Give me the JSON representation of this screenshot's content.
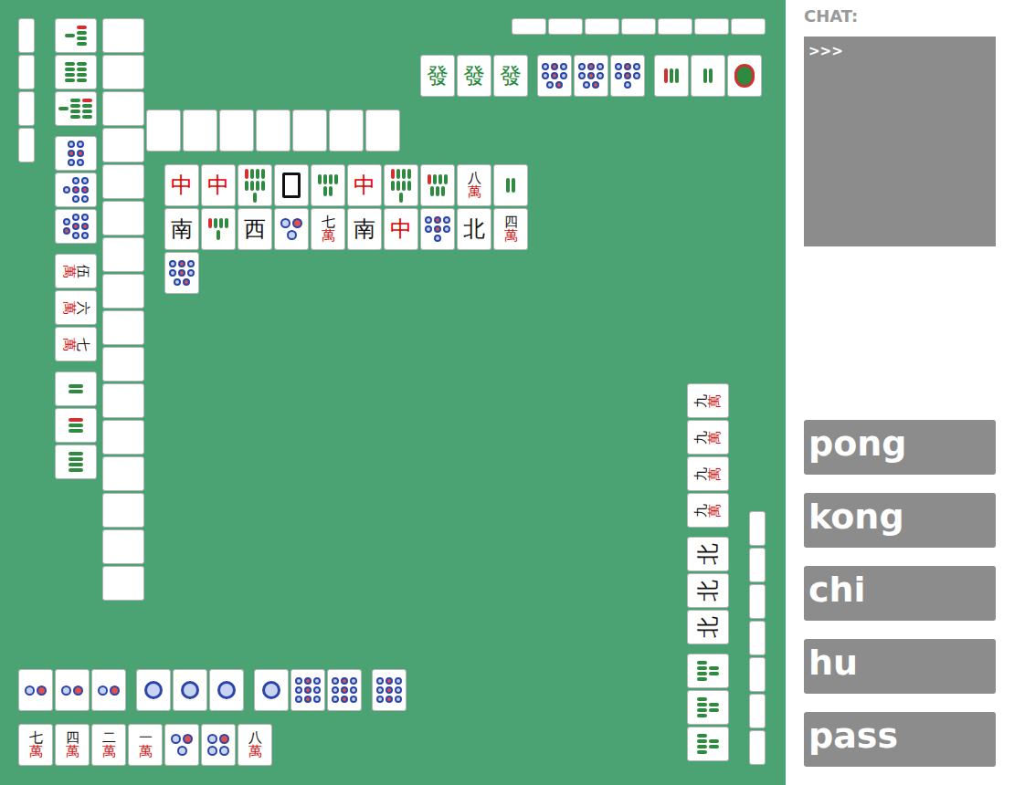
{
  "table": {
    "north": {
      "hidden_count": 7,
      "wall_count": 7,
      "melds": [
        [
          {
            "kind": "honor",
            "label": "發",
            "color": "#1f8a3a"
          },
          {
            "kind": "honor",
            "label": "發",
            "color": "#1f8a3a"
          },
          {
            "kind": "honor",
            "label": "發",
            "color": "#1f8a3a"
          }
        ],
        [
          {
            "kind": "dots",
            "count": 8
          },
          {
            "kind": "dots",
            "count": 8
          },
          {
            "kind": "dots",
            "count": 7
          }
        ],
        [
          {
            "kind": "bamboo",
            "count": 3
          },
          {
            "kind": "bamboo",
            "count": 2
          },
          {
            "kind": "bamboo",
            "count": 1
          }
        ]
      ]
    },
    "west": {
      "hidden_count": 4,
      "wall_count": 16,
      "melds": [
        [
          {
            "kind": "bamboo",
            "count": 5
          },
          {
            "kind": "bamboo",
            "count": 8
          },
          {
            "kind": "bamboo",
            "count": 9
          }
        ],
        [
          {
            "kind": "dots",
            "count": 6
          },
          {
            "kind": "dots",
            "count": 7
          },
          {
            "kind": "dots",
            "count": 8
          }
        ],
        [
          {
            "kind": "man",
            "rank": "伍",
            "suit": "萬"
          },
          {
            "kind": "man",
            "rank": "六",
            "suit": "萬"
          },
          {
            "kind": "man",
            "rank": "七",
            "suit": "萬"
          }
        ],
        [
          {
            "kind": "bamboo",
            "count": 2
          },
          {
            "kind": "bamboo",
            "count": 3
          },
          {
            "kind": "bamboo",
            "count": 4
          }
        ]
      ]
    },
    "east": {
      "hidden_count": 7,
      "melds": [
        [
          {
            "kind": "man",
            "rank": "九",
            "suit": "萬"
          },
          {
            "kind": "man",
            "rank": "九",
            "suit": "萬"
          },
          {
            "kind": "man",
            "rank": "九",
            "suit": "萬"
          },
          {
            "kind": "man",
            "rank": "九",
            "suit": "萬"
          }
        ],
        [
          {
            "kind": "honor",
            "label": "北",
            "color": "#111111"
          },
          {
            "kind": "honor",
            "label": "北",
            "color": "#111111"
          },
          {
            "kind": "honor",
            "label": "北",
            "color": "#111111"
          }
        ],
        [
          {
            "kind": "bamboo",
            "count": 6
          },
          {
            "kind": "bamboo",
            "count": 6
          },
          {
            "kind": "bamboo",
            "count": 6
          }
        ]
      ]
    },
    "south": {
      "melds": [
        [
          {
            "kind": "dots",
            "count": 2
          },
          {
            "kind": "dots",
            "count": 2
          },
          {
            "kind": "dots",
            "count": 2
          }
        ],
        [
          {
            "kind": "dots",
            "count": 1
          },
          {
            "kind": "dots",
            "count": 1
          },
          {
            "kind": "dots",
            "count": 1
          }
        ],
        [
          {
            "kind": "dots",
            "count": 1
          },
          {
            "kind": "dots",
            "count": 9
          },
          {
            "kind": "dots",
            "count": 9
          }
        ],
        [
          {
            "kind": "dots",
            "count": 9
          }
        ]
      ],
      "hand": [
        {
          "kind": "man",
          "rank": "七",
          "suit": "萬"
        },
        {
          "kind": "man",
          "rank": "四",
          "suit": "萬"
        },
        {
          "kind": "man",
          "rank": "二",
          "suit": "萬"
        },
        {
          "kind": "man",
          "rank": "一",
          "suit": "萬"
        },
        {
          "kind": "dots",
          "count": 3
        },
        {
          "kind": "dots",
          "count": 4
        },
        {
          "kind": "man",
          "rank": "八",
          "suit": "萬"
        }
      ]
    },
    "discards": [
      [
        {
          "kind": "honor",
          "label": "中",
          "color": "#e00000"
        },
        {
          "kind": "honor",
          "label": "中",
          "color": "#e00000"
        },
        {
          "kind": "bamboo",
          "count": 9
        },
        {
          "kind": "white"
        },
        {
          "kind": "bamboo",
          "count": 6
        },
        {
          "kind": "honor",
          "label": "中",
          "color": "#e00000"
        },
        {
          "kind": "bamboo",
          "count": 9
        },
        {
          "kind": "bamboo",
          "count": 7
        },
        {
          "kind": "man",
          "rank": "八",
          "suit": "萬"
        },
        {
          "kind": "bamboo",
          "count": 2
        }
      ],
      [
        {
          "kind": "honor",
          "label": "南",
          "color": "#111111"
        },
        {
          "kind": "bamboo",
          "count": 5
        },
        {
          "kind": "honor",
          "label": "西",
          "color": "#111111"
        },
        {
          "kind": "dots",
          "count": 3
        },
        {
          "kind": "man",
          "rank": "七",
          "suit": "萬"
        },
        {
          "kind": "honor",
          "label": "南",
          "color": "#111111"
        },
        {
          "kind": "honor",
          "label": "中",
          "color": "#e00000"
        },
        {
          "kind": "dots",
          "count": 7
        },
        {
          "kind": "honor",
          "label": "北",
          "color": "#111111"
        },
        {
          "kind": "man",
          "rank": "四",
          "suit": "萬"
        }
      ],
      [
        {
          "kind": "dots",
          "count": 8
        }
      ]
    ]
  },
  "chat": {
    "label": "CHAT:",
    "log": ">>>"
  },
  "buttons": [
    {
      "label": "pong"
    },
    {
      "label": "kong"
    },
    {
      "label": "chi"
    },
    {
      "label": "hu"
    },
    {
      "label": "pass"
    }
  ]
}
